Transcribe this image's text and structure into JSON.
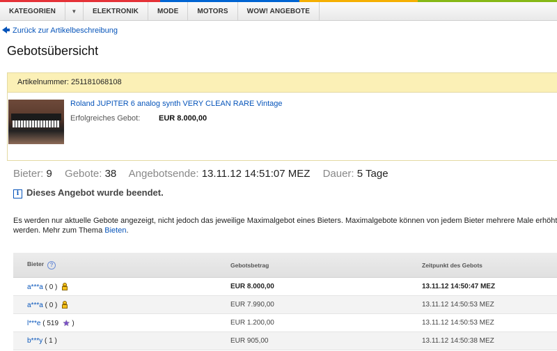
{
  "nav": {
    "items": [
      "KATEGORIEN",
      "ELEKTRONIK",
      "MODE",
      "MOTORS",
      "WOW! ANGEBOTE"
    ],
    "dropdown_icon": "chevron-down-icon"
  },
  "back_link": "Zurück zur Artikelbeschreibung",
  "page_title": "Gebotsübersicht",
  "item": {
    "number_text": "Artikelnummer: 251181068108",
    "title": "Roland JUPITER 6 analog synth VERY CLEAN RARE Vintage",
    "price_label": "Erfolgreiches Gebot:",
    "price_value": "EUR 8.000,00"
  },
  "stats": {
    "bidders_label": "Bieter:",
    "bidders_value": "9",
    "bids_label": "Gebote:",
    "bids_value": "38",
    "end_label": "Angebotsende:",
    "end_value": "13.11.12 14:51:07 MEZ",
    "duration_label": "Dauer:",
    "duration_value": "5 Tage"
  },
  "ended_text": "Dieses Angebot wurde beendet.",
  "note": {
    "text": "Es werden nur aktuelle Gebote angezeigt, nicht jedoch das jeweilige Maximalgebot eines Bieters. Maximalgebote können von jedem Bieter mehrere Male erhöht",
    "text2": "werden. Mehr zum Thema",
    "link": "Bieten",
    "end": "."
  },
  "table": {
    "headers": [
      "Bieter",
      "Gebotsbetrag",
      "Zeitpunkt des Gebots"
    ],
    "rows": [
      {
        "bidder": "a***a",
        "feedback": "0",
        "icon": "new-member-icon",
        "amount": "EUR 8.000,00",
        "time": "13.11.12 14:50:47 MEZ",
        "bold": true
      },
      {
        "bidder": "a***a",
        "feedback": "0",
        "icon": "new-member-icon",
        "amount": "EUR 7.990,00",
        "time": "13.11.12 14:50:53 MEZ",
        "bold": false
      },
      {
        "bidder": "l***e",
        "feedback": "519",
        "icon": "purple-star-icon",
        "amount": "EUR 1.200,00",
        "time": "13.11.12 14:50:53 MEZ",
        "bold": false
      },
      {
        "bidder": "b***y",
        "feedback": "1",
        "icon": "",
        "amount": "EUR 905,00",
        "time": "13.11.12 14:50:38 MEZ",
        "bold": false
      }
    ]
  },
  "colors": {
    "link": "#0654ba",
    "header_bg": "#fbf0b6",
    "nav_red": "#e53238",
    "nav_blue": "#0064d2",
    "nav_yellow": "#f5af02",
    "nav_green": "#86b817"
  }
}
